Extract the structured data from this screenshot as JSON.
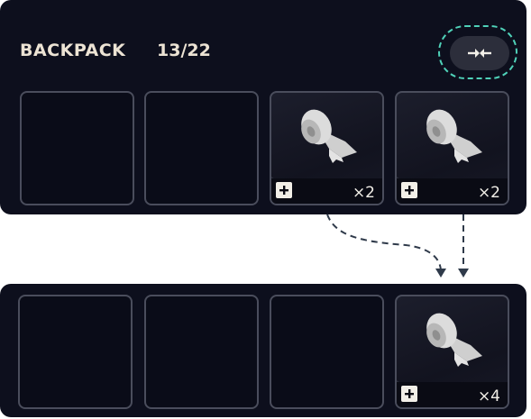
{
  "backpack": {
    "title": "BACKPACK",
    "count": "13/22",
    "sort_icon": "merge-arrows-icon"
  },
  "before_slots": [
    {
      "filled": false
    },
    {
      "filled": false
    },
    {
      "filled": true,
      "item": "bandage-roll",
      "quantity": "×2"
    },
    {
      "filled": true,
      "item": "bandage-roll",
      "quantity": "×2"
    }
  ],
  "after_slots": [
    {
      "filled": false
    },
    {
      "filled": false
    },
    {
      "filled": false
    },
    {
      "filled": true,
      "item": "bandage-roll",
      "quantity": "×4"
    }
  ],
  "colors": {
    "panel": "#0d0f1d",
    "slot_border": "#4a4d5c",
    "accent_ring": "#4fd1b8",
    "text": "#ece3d4",
    "arrow": "#2f3a4a"
  }
}
